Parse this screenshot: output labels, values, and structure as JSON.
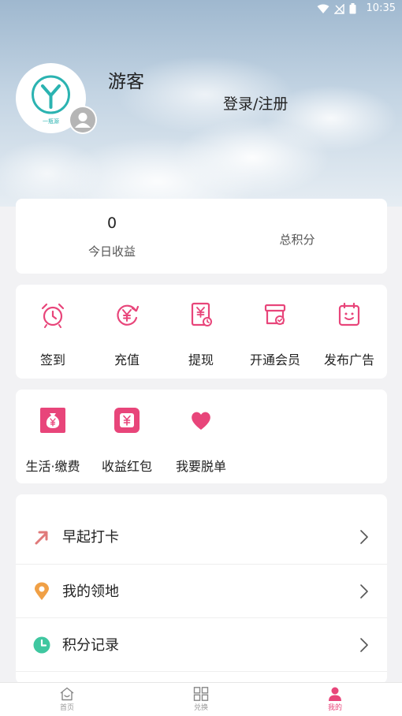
{
  "status_bar": {
    "time": "10:35"
  },
  "profile": {
    "avatar_logo_text": "一瓶源",
    "name": "游客",
    "login_label": "登录/注册"
  },
  "stats": {
    "today_value": "0",
    "today_label": "今日收益",
    "total_label": "总积分"
  },
  "quick_actions": [
    {
      "label": "签到",
      "icon": "alarm-clock-icon"
    },
    {
      "label": "充值",
      "icon": "yuan-refresh-icon"
    },
    {
      "label": "提现",
      "icon": "yuan-document-icon"
    },
    {
      "label": "开通会员",
      "icon": "member-box-icon"
    },
    {
      "label": "发布广告",
      "icon": "ad-board-icon"
    }
  ],
  "services": [
    {
      "label": "生活·缴费",
      "icon": "money-bag-icon"
    },
    {
      "label": "收益红包",
      "icon": "red-packet-icon"
    },
    {
      "label": "我要脱单",
      "icon": "heart-icon"
    }
  ],
  "menu": [
    {
      "label": "早起打卡",
      "icon": "arrow-up-right-icon"
    },
    {
      "label": "我的领地",
      "icon": "location-pin-icon"
    },
    {
      "label": "积分记录",
      "icon": "clock-icon"
    }
  ],
  "tabbar": [
    {
      "label": "首页",
      "icon": "home-icon"
    },
    {
      "label": "兑换",
      "icon": "grid-icon"
    },
    {
      "label": "我的",
      "icon": "person-icon",
      "active": true
    }
  ],
  "colors": {
    "accent": "#e8457a",
    "pin": "#f0a046",
    "clock": "#3fc7a0",
    "arrow": "#e07a7a"
  }
}
